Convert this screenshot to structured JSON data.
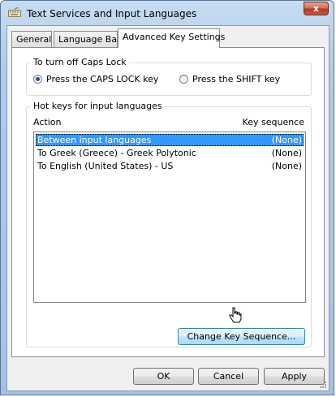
{
  "window": {
    "title": "Text Services and Input Languages",
    "close_label": "x"
  },
  "tabs": [
    {
      "label": "General",
      "active": false
    },
    {
      "label": "Language Bar",
      "active": false
    },
    {
      "label": "Advanced Key Settings",
      "active": true
    }
  ],
  "caps_lock_group": {
    "label": "To turn off Caps Lock",
    "options": [
      {
        "label": "Press the CAPS LOCK key",
        "checked": true
      },
      {
        "label": "Press the SHIFT key",
        "checked": false
      }
    ]
  },
  "hotkeys_group": {
    "label": "Hot keys for input languages",
    "columns": {
      "action": "Action",
      "sequence": "Key sequence"
    },
    "rows": [
      {
        "action": "Between input languages",
        "sequence": "(None)",
        "selected": true
      },
      {
        "action": "To Greek (Greece) - Greek Polytonic",
        "sequence": "(None)",
        "selected": false
      },
      {
        "action": "To English (United States) - US",
        "sequence": "(None)",
        "selected": false
      }
    ],
    "change_button": "Change Key Sequence..."
  },
  "footer": {
    "ok": "OK",
    "cancel": "Cancel",
    "apply": "Apply"
  }
}
